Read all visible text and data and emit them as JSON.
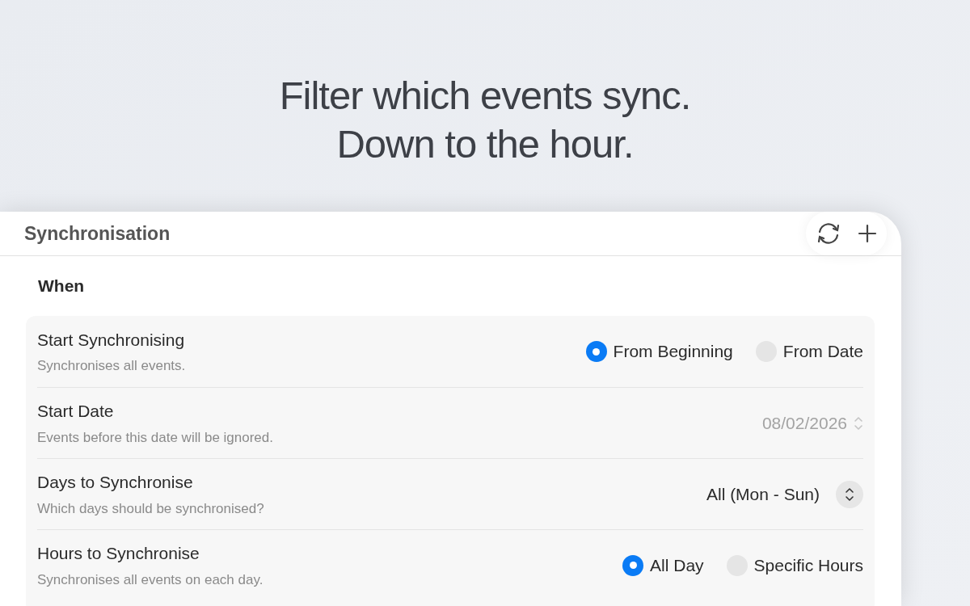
{
  "headline": [
    "Filter which events sync.",
    "Down to the hour."
  ],
  "window": {
    "title": "Synchronisation"
  },
  "section": {
    "title": "When"
  },
  "rows": [
    {
      "kind": "radio",
      "title": "Start Synchronising",
      "subtitle": "Synchronises all events.",
      "options": [
        {
          "label": "From Beginning",
          "selected": true
        },
        {
          "label": "From Date",
          "selected": false
        }
      ]
    },
    {
      "kind": "date",
      "title": "Start Date",
      "subtitle": "Events before this date will be ignored.",
      "value": "08/02/2026",
      "disabled": true
    },
    {
      "kind": "popup",
      "title": "Days to Synchronise",
      "subtitle": "Which days should be synchronised?",
      "value": "All (Mon - Sun)"
    },
    {
      "kind": "radio",
      "title": "Hours to Synchronise",
      "subtitle": "Synchronises all events on each day.",
      "options": [
        {
          "label": "All Day",
          "selected": true
        },
        {
          "label": "Specific Hours",
          "selected": false
        }
      ]
    }
  ]
}
